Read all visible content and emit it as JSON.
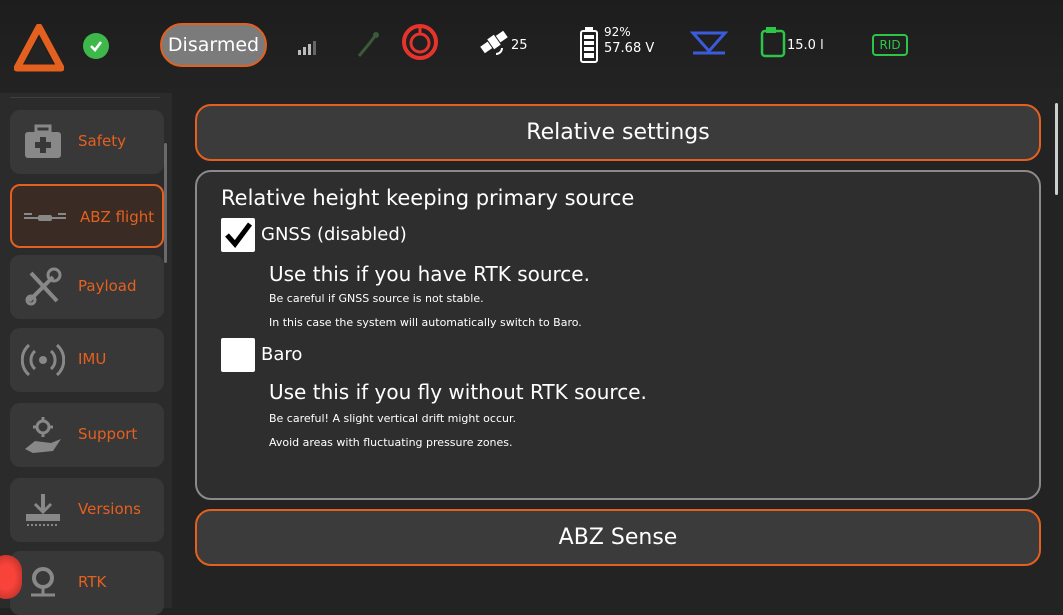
{
  "topbar": {
    "arm_state": "Disarmed",
    "satellites": "25",
    "battery_percent": "92%",
    "battery_voltage": "57.68 V",
    "tank_level": "15.0 l",
    "rid_label": "RID"
  },
  "sidebar": {
    "items": [
      {
        "label": "Safety",
        "icon": "first-aid-kit-icon",
        "active": false
      },
      {
        "label": "ABZ flight",
        "icon": "drone-icon",
        "active": true
      },
      {
        "label": "Payload",
        "icon": "tools-icon",
        "active": false
      },
      {
        "label": "IMU",
        "icon": "broadcast-icon",
        "active": false
      },
      {
        "label": "Support",
        "icon": "support-hand-gear-icon",
        "active": false
      },
      {
        "label": "Versions",
        "icon": "download-icon",
        "active": false
      },
      {
        "label": "RTK",
        "icon": "location-pin-icon",
        "active": false
      }
    ]
  },
  "main": {
    "relative_settings_label": "Relative settings",
    "panel": {
      "title": "Relative height keeping primary source",
      "options": [
        {
          "label": "GNSS (disabled)",
          "checked": true,
          "headline": "Use this if you have RTK source.",
          "note1": "Be careful if GNSS source is not stable.",
          "note2": "In this case the system will automatically switch to Baro."
        },
        {
          "label": "Baro",
          "checked": false,
          "headline": "Use this if you fly without RTK source.",
          "note1": "Be careful! A slight vertical drift might occur.",
          "note2": "Avoid areas with fluctuating pressure zones."
        }
      ]
    },
    "abz_sense_label": "ABZ Sense"
  },
  "colors": {
    "accent": "#e4601f",
    "ok_green": "#3fb84b",
    "rid_green": "#2dc548",
    "rtk_blue": "#3b5bdb",
    "alert_red": "#e8332c"
  }
}
